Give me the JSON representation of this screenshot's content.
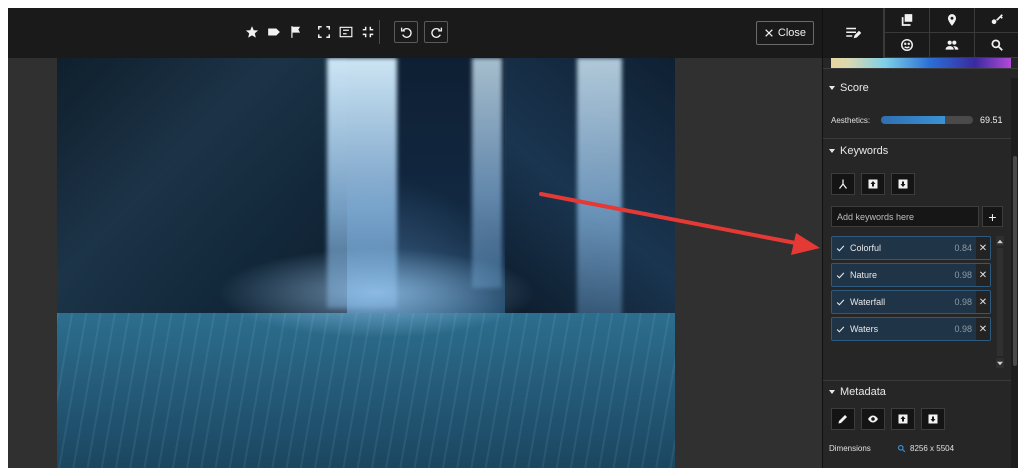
{
  "toolbar": {
    "icons": [
      "star-icon",
      "tag-icon",
      "flag-icon",
      "fit-screen-icon",
      "actual-size-icon",
      "fullscreen-icon",
      "rotate-left-icon",
      "rotate-right-icon"
    ],
    "close_label": "Close"
  },
  "panel": {
    "header_icons": [
      "edit-list-icon",
      "copy-icon",
      "pin-icon",
      "key-icon",
      "face-icon",
      "people-icon",
      "search-icon"
    ],
    "score": {
      "title": "Score",
      "aesthetics_label": "Aesthetics:",
      "aesthetics_value": "69.51",
      "aesthetics_fill_pct": 70
    },
    "keywords": {
      "title": "Keywords",
      "input_placeholder": "Add keywords here",
      "add_label": "+",
      "items": [
        {
          "name": "Colorful",
          "score": "0.84"
        },
        {
          "name": "Nature",
          "score": "0.98"
        },
        {
          "name": "Waterfall",
          "score": "0.98"
        },
        {
          "name": "Waters",
          "score": "0.98"
        }
      ]
    },
    "metadata": {
      "title": "Metadata",
      "dimensions_label": "Dimensions",
      "dimensions_value": "8256 x 5504"
    }
  },
  "colors": {
    "accent": "#3a92d6",
    "arrow": "#e53935",
    "keyword_bg": "#1f3447"
  }
}
